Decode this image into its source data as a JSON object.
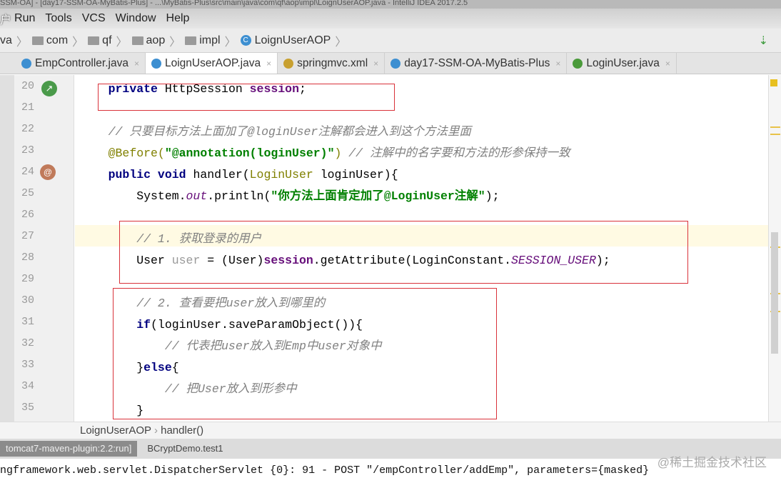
{
  "window_title": "SSM-OA] - [day17-SSM-OA-MyBatis-Plus] - ...\\MyBatis-Plus\\src\\main\\java\\com\\qf\\aop\\impl\\LoignUserAOP.java - IntelliJ IDEA 2017.2.5",
  "menu": {
    "sub_char": "户",
    "items": [
      "Run",
      "Tools",
      "VCS",
      "Window",
      "Help"
    ]
  },
  "breadcrumb": {
    "items": [
      "va",
      "com",
      "qf",
      "aop",
      "impl",
      "LoignUserAOP"
    ]
  },
  "tabs": [
    {
      "label": "EmpController.java",
      "icon_color": "#3d8fd1",
      "active": false
    },
    {
      "label": "LoignUserAOP.java",
      "icon_color": "#3d8fd1",
      "active": true
    },
    {
      "label": "springmvc.xml",
      "icon_color": "#c8a030",
      "active": false
    },
    {
      "label": "day17-SSM-OA-MyBatis-Plus",
      "icon_color": "#3d8fd1",
      "active": false
    },
    {
      "label": "LoginUser.java",
      "icon_color": "#4a9a3a",
      "active": false
    }
  ],
  "line_numbers": [
    "20",
    "21",
    "22",
    "23",
    "24",
    "25",
    "26",
    "27",
    "28",
    "29",
    "30",
    "31",
    "32",
    "33",
    "34",
    "35"
  ],
  "code": [
    [
      {
        "t": "    "
      },
      {
        "t": "private ",
        "c": "kw"
      },
      {
        "t": "HttpSession "
      },
      {
        "t": "session",
        "c": "fld"
      },
      {
        "t": ";"
      }
    ],
    [],
    [
      {
        "t": "    "
      },
      {
        "t": "// 只要目标方法上面加了@loginUser注解都会进入到这个方法里面",
        "c": "cm"
      }
    ],
    [
      {
        "t": "    "
      },
      {
        "t": "@Before(",
        "c": "ann"
      },
      {
        "t": "\"@annotation(loginUser)\"",
        "c": "str"
      },
      {
        "t": ") ",
        "c": "ann"
      },
      {
        "t": "// 注解中的名字要和方法的形参保持一致",
        "c": "cm"
      }
    ],
    [
      {
        "t": "    "
      },
      {
        "t": "public void ",
        "c": "kw"
      },
      {
        "t": "handler("
      },
      {
        "t": "LoginUser ",
        "c": "ann"
      },
      {
        "t": "loginUser){"
      }
    ],
    [
      {
        "t": "        System."
      },
      {
        "t": "out",
        "c": "st"
      },
      {
        "t": ".println("
      },
      {
        "t": "\"你方法上面肯定加了@LoginUser注解\"",
        "c": "str"
      },
      {
        "t": ");"
      }
    ],
    [],
    [
      {
        "t": "        "
      },
      {
        "t": "// 1. 获取登录的用户",
        "c": "cm"
      }
    ],
    [
      {
        "t": "        User "
      },
      {
        "t": "user",
        "c": "un"
      },
      {
        "t": " = (User)"
      },
      {
        "t": "session",
        "c": "fld"
      },
      {
        "t": ".getAttribute(LoginConstant."
      },
      {
        "t": "SESSION_USER",
        "c": "st"
      },
      {
        "t": ");"
      }
    ],
    [],
    [
      {
        "t": "        "
      },
      {
        "t": "// 2. 查看要把user放入到哪里的",
        "c": "cm"
      }
    ],
    [
      {
        "t": "        "
      },
      {
        "t": "if",
        "c": "kw"
      },
      {
        "t": "(loginUser.saveParamObject()){"
      }
    ],
    [
      {
        "t": "            "
      },
      {
        "t": "// 代表把user放入到Emp中user对象中",
        "c": "cm"
      }
    ],
    [
      {
        "t": "        }"
      },
      {
        "t": "else",
        "c": "kw"
      },
      {
        "t": "{"
      }
    ],
    [
      {
        "t": "            "
      },
      {
        "t": "// 把User放入到形参中",
        "c": "cm"
      }
    ],
    [
      {
        "t": "        }"
      }
    ]
  ],
  "editor_breadcrumb": [
    "LoignUserAOP",
    "handler()"
  ],
  "run_tabs": [
    "tomcat7-maven-plugin:2.2:run]",
    "BCryptDemo.test1"
  ],
  "console_line": "ngframework.web.servlet.DispatcherServlet {0}: 91 - POST \"/empController/addEmp\", parameters={masked}",
  "watermark": "@稀土掘金技术社区"
}
